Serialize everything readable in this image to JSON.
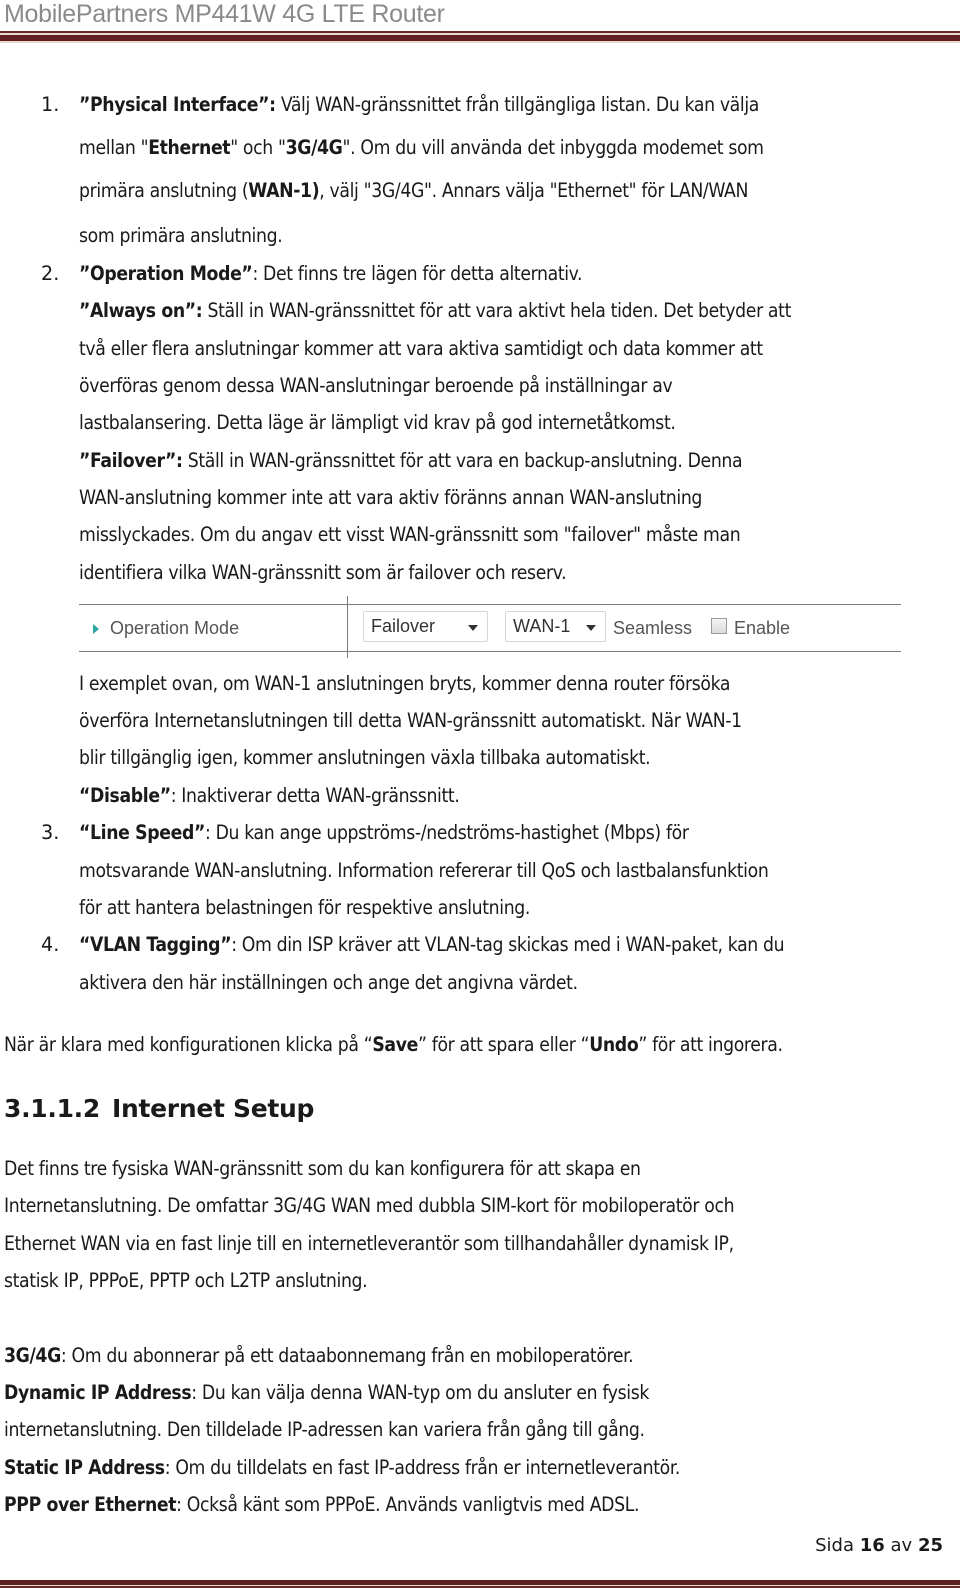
{
  "header": {
    "title": "MobilePartners MP441W 4G LTE Router"
  },
  "list": {
    "item1": {
      "number": "1.",
      "term": "”Physical Interface”:",
      "lines": [
        " Välj WAN-gränssnittet från tillgängliga listan. Du kan välja",
        "mellan \"",
        "Ethernet",
        "\" och \"",
        "3G/4G",
        "\". Om du vill använda det inbyggda modemet som",
        "primära anslutning (",
        "WAN-1)",
        ", välj \"3G/4G\". Annars välja \"Ethernet\" för LAN/WAN",
        "som primära anslutning."
      ]
    },
    "item2": {
      "number": "2.",
      "term": "”Operation Mode”",
      "text": ": Det finns tre lägen för detta alternativ.",
      "always_on": {
        "term": "”Always on”:",
        "lines": [
          " Ställ in WAN-gränssnittet för att vara aktivt hela tiden. Det betyder att",
          "två eller flera anslutningar kommer att vara aktiva samtidigt och data kommer att",
          "överföras genom dessa WAN-anslutningar beroende på inställningar av",
          "lastbalansering. Detta läge är lämpligt vid krav på god internetåtkomst."
        ]
      },
      "failover": {
        "term": "”Failover”:",
        "lines": [
          " Ställ in WAN-gränssnittet för att vara en backup-anslutning. Denna",
          "WAN-anslutning kommer inte att vara aktiv föränns annan WAN-anslutning",
          "misslyckades. Om du angav ett visst WAN-gränssnitt som \"failover\" måste man",
          "identifiera vilka WAN-gränssnitt som är failover och reserv."
        ]
      },
      "example_lines": [
        "I exemplet ovan, om WAN-1 anslutningen bryts, kommer denna router försöka",
        "överföra Internetanslutningen till detta WAN-gränssnitt automatiskt. När WAN-1",
        "blir tillgänglig igen, kommer anslutningen växla tillbaka automatiskt."
      ],
      "disable": {
        "term": "“Disable”",
        "text": ": Inaktiverar detta WAN-gränssnitt."
      }
    },
    "item3": {
      "number": "3.",
      "term": "“Line Speed”",
      "lines": [
        ": Du kan ange uppströms-/nedströms-hastighet (Mbps) för",
        "motsvarande WAN-anslutning. Information refererar till QoS och lastbalansfunktion",
        "för att hantera belastningen för respektive anslutning."
      ]
    },
    "item4": {
      "number": "4.",
      "term": "“VLAN Tagging”",
      "lines": [
        ": Om din ISP kräver att VLAN-tag skickas med i WAN-paket, kan du",
        "aktivera den här inställningen och ange det angivna värdet."
      ]
    }
  },
  "widget": {
    "label": "Operation Mode",
    "mode_select": {
      "value": "Failover"
    },
    "wan_select": {
      "value": "WAN-1"
    },
    "seamless_label": "Seamless",
    "enable_label": "Enable",
    "enable_checked": false
  },
  "save_note": {
    "pre": "När är klara med konfigurationen klicka på “",
    "save": "Save",
    "mid": "” för att spara eller “",
    "undo": "Undo",
    "post": "” för att ingorera."
  },
  "section": {
    "number": "3.1.1.2",
    "title": "Internet Setup",
    "intro_lines": [
      "Det finns tre fysiska WAN-gränssnitt som du kan konfigurera för att skapa en",
      "Internetanslutning. De omfattar 3G/4G WAN med dubbla SIM-kort för mobiloperatör och",
      "Ethernet WAN via en fast linje till en internetleverantör som tillhandahåller dynamisk IP,",
      "statisk IP, PPPoE, PPTP och L2TP anslutning."
    ],
    "defs": [
      {
        "term": "3G/4G",
        "text": ": Om du abonnerar på ett dataabonnemang från en mobiloperatörer."
      },
      {
        "term": "Dynamic IP Address",
        "text": ": Du kan välja denna WAN-typ om du ansluter en fysisk",
        "cont": "internetanslutning. Den tilldelade IP-adressen kan variera från gång till gång."
      },
      {
        "term": "Static IP Address",
        "text": ": Om du tilldelats en fast IP-address från er internetleverantör."
      },
      {
        "term": "PPP over Ethernet",
        "text": ": Också känt som PPPoE. Används vanligtvis med ADSL."
      }
    ]
  },
  "footer": {
    "page_label": "Sida",
    "page": "16",
    "of_label": "av",
    "total": "25"
  }
}
